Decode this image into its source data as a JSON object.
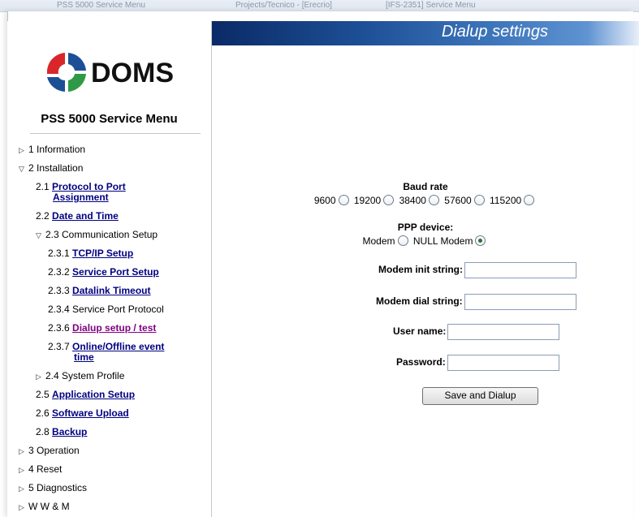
{
  "browser": {
    "tabs": [
      "PSS 5000 Service Menu",
      "Projects/Tecnico - [Erecrio]",
      "[IFS-2351] Service Menu"
    ]
  },
  "logo": {
    "text": "DOMS",
    "colors": {
      "red": "#d9262b",
      "blue": "#1d4f96",
      "green": "#2f9a45"
    }
  },
  "sidebar": {
    "title": "PSS 5000 Service Menu",
    "items": [
      {
        "prefix": "1 Information",
        "expander": "collapsed"
      },
      {
        "prefix": "2 Installation",
        "expander": "expanded"
      },
      {
        "prefix": "2.1",
        "link_line1": "Protocol to Port",
        "link_line2": "Assignment"
      },
      {
        "prefix": "2.2",
        "link": "Date and Time"
      },
      {
        "prefix": "2.3 Communication Setup",
        "expander": "expanded"
      },
      {
        "prefix": "2.3.1",
        "link": "TCP/IP Setup"
      },
      {
        "prefix": "2.3.2",
        "link": "Service Port Setup"
      },
      {
        "prefix": "2.3.3",
        "link": "Datalink Timeout"
      },
      {
        "prefix": "2.3.4 Service Port Protocol"
      },
      {
        "prefix": "2.3.6",
        "link": "Dialup setup / test"
      },
      {
        "prefix": "2.3.7",
        "link_line1": "Online/Offline event",
        "link_line2": "time"
      },
      {
        "prefix": "2.4 System Profile",
        "expander": "collapsed"
      },
      {
        "prefix": "2.5",
        "link": "Application Setup"
      },
      {
        "prefix": "2.6",
        "link": "Software Upload"
      },
      {
        "prefix": "2.8",
        "link": "Backup"
      },
      {
        "prefix": "3 Operation",
        "expander": "collapsed"
      },
      {
        "prefix": "4 Reset",
        "expander": "collapsed"
      },
      {
        "prefix": "5 Diagnostics",
        "expander": "collapsed"
      },
      {
        "prefix": "W W & M",
        "expander": "collapsed"
      }
    ]
  },
  "header": {
    "title": "Dialup settings"
  },
  "form": {
    "baud_label": "Baud rate",
    "baud_options": [
      "9600",
      "19200",
      "38400",
      "57600",
      "115200"
    ],
    "ppp_label": "PPP device:",
    "ppp_options": [
      "Modem",
      "NULL Modem"
    ],
    "ppp_selected": "NULL Modem",
    "init_label": "Modem init string:",
    "init_value": "",
    "dial_label": "Modem dial string:",
    "dial_value": "",
    "user_label": "User name:",
    "user_value": "",
    "pass_label": "Password:",
    "pass_value": "",
    "submit_label": "Save and Dialup"
  }
}
